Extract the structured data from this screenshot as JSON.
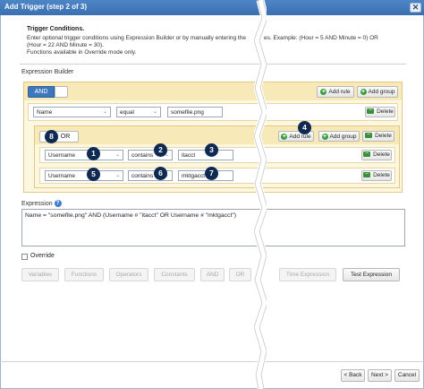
{
  "dialog": {
    "title": "Add Trigger (step 2 of 3)",
    "close_glyph": "✕",
    "intro_title": "Trigger Conditions.",
    "intro_text": "Enter optional trigger conditions using Expression Builder or by manually entering the",
    "intro_text_2": "es. Example: (Hour = 5 AND Minute = 0) OR",
    "intro_text_3": "(Hour = 22 AND Minute = 30).",
    "intro_text_4": "Functions available in Override mode only."
  },
  "builder": {
    "label": "Expression Builder",
    "root_group": {
      "operator": "AND",
      "add_rule": "Add rule",
      "add_group": "Add group"
    },
    "rule1": {
      "field": "Name",
      "operator": "equal",
      "value": "somefile.png",
      "delete": "Delete"
    },
    "nested_group": {
      "operator": "OR",
      "add_rule": "Add rule",
      "add_group": "Add group",
      "delete": "Delete",
      "rules": [
        {
          "field": "Username",
          "operator": "contains",
          "value": "itacct",
          "delete": "Delete"
        },
        {
          "field": "Username",
          "operator": "contains",
          "value": "mktgacct",
          "delete": "Delete"
        }
      ]
    }
  },
  "callouts": [
    "1",
    "2",
    "3",
    "4",
    "5",
    "6",
    "7",
    "8"
  ],
  "expression": {
    "label": "Expression",
    "help_glyph": "?",
    "value": "Name = \"somefile.png\" AND (Username # \"itacct\" OR Username # \"mktgacct\")"
  },
  "override": {
    "label": "Override",
    "checked": false
  },
  "toolbar": {
    "variables": "Variables",
    "functions": "Functions",
    "operators": "Operators",
    "constants": "Constants",
    "and": "AND",
    "or": "OR",
    "time_expression": "Time Expression",
    "test_expression": "Test Expression"
  },
  "footer": {
    "back": "< Back",
    "next": "Next >",
    "cancel": "Cancel"
  },
  "colors": {
    "titlebar": "#3f76b8",
    "group_fill": "#fdf5dc",
    "group_border": "#e3c97f",
    "badge": "#0f2a52",
    "add_icon": "#3c9a3c"
  }
}
